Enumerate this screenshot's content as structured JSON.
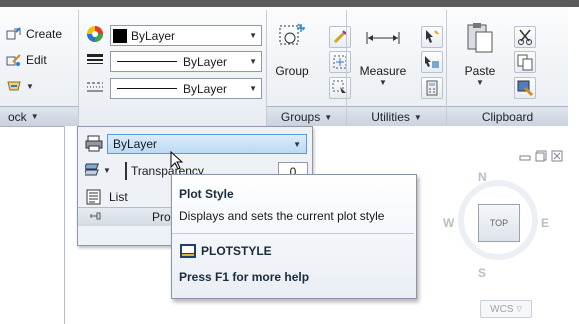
{
  "ribbon": {
    "draw_panel": {
      "create_label": "Create",
      "edit_label": "Edit",
      "title": "ock"
    },
    "properties_panel": {
      "color_value": "ByLayer",
      "lineweight_value": "ByLayer",
      "linetype_value": "ByLayer"
    },
    "groups_panel": {
      "group_label": "Group",
      "title": "Groups"
    },
    "utilities_panel": {
      "measure_label": "Measure",
      "title": "Utilities"
    },
    "clipboard_panel": {
      "paste_label": "Paste",
      "title": "Clipboard"
    }
  },
  "properties_expanded": {
    "plot_style_value": "ByLayer",
    "transparency_label": "Transparency",
    "transparency_value": "0",
    "list_label": "List",
    "panel_title": "Pro"
  },
  "tooltip": {
    "title": "Plot Style",
    "description": "Displays and sets the current plot style",
    "command": "PLOTSTYLE",
    "help": "Press F1 for more help"
  },
  "viewcube": {
    "north": "N",
    "south": "S",
    "east": "E",
    "west": "W",
    "top": "TOP",
    "wcs": "WCS"
  },
  "colors": {
    "accent_blue": "#cfe4f8",
    "ribbon_bg": "#e8ecf1"
  }
}
